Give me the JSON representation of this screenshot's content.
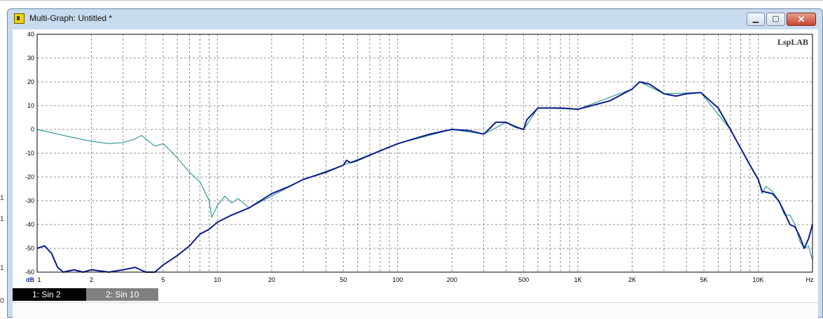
{
  "window": {
    "title": "Multi-Graph: Untitled *",
    "buttons": {
      "minimize": "▁",
      "maximize": "▢",
      "close": "✕"
    }
  },
  "background": {
    "y_ticks": [
      "1",
      "1",
      "1",
      "0"
    ]
  },
  "tabs": [
    {
      "label": "1: Sin 2",
      "active": true
    },
    {
      "label": "2: Sin 10",
      "active": false
    }
  ],
  "chart_data": {
    "type": "line",
    "watermark": "LspLAB",
    "xlabel": "Hz",
    "ylabel": "dB",
    "x_scale": "log",
    "xlim": [
      1,
      20000
    ],
    "ylim": [
      -60,
      40
    ],
    "grid": true,
    "x_ticks": [
      {
        "v": 1,
        "label": "1"
      },
      {
        "v": 2,
        "label": "2"
      },
      {
        "v": 5,
        "label": "5"
      },
      {
        "v": 10,
        "label": "10"
      },
      {
        "v": 20,
        "label": "20"
      },
      {
        "v": 50,
        "label": "50"
      },
      {
        "v": 100,
        "label": "100"
      },
      {
        "v": 200,
        "label": "200"
      },
      {
        "v": 500,
        "label": "500"
      },
      {
        "v": 1000,
        "label": "1K"
      },
      {
        "v": 2000,
        "label": "2K"
      },
      {
        "v": 5000,
        "label": "5K"
      },
      {
        "v": 10000,
        "label": "10K"
      }
    ],
    "y_ticks": [
      40,
      30,
      20,
      10,
      0,
      -10,
      -20,
      -30,
      -40,
      -50,
      -60
    ],
    "colors": {
      "series_1": "#0a1a8c",
      "series_2": "#138a8a",
      "grid": "#909090",
      "frame": "#000000"
    },
    "series": [
      {
        "id": "sin-2",
        "points": [
          [
            1,
            -50
          ],
          [
            1.1,
            -49
          ],
          [
            1.2,
            -52
          ],
          [
            1.3,
            -58
          ],
          [
            1.4,
            -60
          ],
          [
            1.6,
            -59
          ],
          [
            1.8,
            -60
          ],
          [
            2.0,
            -59
          ],
          [
            2.5,
            -60
          ],
          [
            3,
            -59
          ],
          [
            3.5,
            -58
          ],
          [
            4,
            -60
          ],
          [
            4.5,
            -60
          ],
          [
            5,
            -57
          ],
          [
            6,
            -53
          ],
          [
            7,
            -49
          ],
          [
            8,
            -44
          ],
          [
            9,
            -42
          ],
          [
            10,
            -39
          ],
          [
            12,
            -36
          ],
          [
            15,
            -33
          ],
          [
            20,
            -27
          ],
          [
            25,
            -24
          ],
          [
            30,
            -21
          ],
          [
            40,
            -18
          ],
          [
            50,
            -15
          ],
          [
            52,
            -13
          ],
          [
            55,
            -14
          ],
          [
            60,
            -13
          ],
          [
            80,
            -9
          ],
          [
            100,
            -6
          ],
          [
            150,
            -2
          ],
          [
            200,
            0
          ],
          [
            250,
            -0.5
          ],
          [
            300,
            -2
          ],
          [
            320,
            0
          ],
          [
            350,
            3
          ],
          [
            400,
            3
          ],
          [
            450,
            1
          ],
          [
            500,
            0
          ],
          [
            520,
            4
          ],
          [
            600,
            9
          ],
          [
            800,
            9
          ],
          [
            1000,
            8.5
          ],
          [
            1500,
            12
          ],
          [
            2000,
            17
          ],
          [
            2200,
            20
          ],
          [
            2500,
            19
          ],
          [
            3000,
            15
          ],
          [
            3500,
            14
          ],
          [
            4000,
            15
          ],
          [
            4800,
            15.5
          ],
          [
            6000,
            9
          ],
          [
            7000,
            0
          ],
          [
            8000,
            -8
          ],
          [
            9000,
            -15
          ],
          [
            10000,
            -21
          ],
          [
            10500,
            -26
          ],
          [
            12000,
            -27
          ],
          [
            13000,
            -30
          ],
          [
            14000,
            -35
          ],
          [
            15000,
            -40
          ],
          [
            16000,
            -41
          ],
          [
            17000,
            -45
          ],
          [
            18000,
            -50
          ],
          [
            19000,
            -46
          ],
          [
            20000,
            -40
          ]
        ]
      },
      {
        "id": "sin-10",
        "points": [
          [
            1,
            0
          ],
          [
            1.5,
            -3
          ],
          [
            2,
            -5
          ],
          [
            2.5,
            -6
          ],
          [
            3,
            -5.5
          ],
          [
            3.5,
            -4
          ],
          [
            3.8,
            -2.5
          ],
          [
            4,
            -4
          ],
          [
            4.5,
            -7
          ],
          [
            5,
            -6
          ],
          [
            5.5,
            -9
          ],
          [
            6,
            -12
          ],
          [
            7,
            -18
          ],
          [
            8,
            -22
          ],
          [
            9,
            -30
          ],
          [
            9.3,
            -37
          ],
          [
            10,
            -32
          ],
          [
            11,
            -28
          ],
          [
            12,
            -31
          ],
          [
            13,
            -29
          ],
          [
            15,
            -33
          ],
          [
            20,
            -28
          ],
          [
            30,
            -21
          ],
          [
            50,
            -15
          ],
          [
            100,
            -6
          ],
          [
            200,
            0
          ],
          [
            300,
            -2
          ],
          [
            400,
            3
          ],
          [
            500,
            0
          ],
          [
            600,
            9
          ],
          [
            1000,
            8.5
          ],
          [
            2000,
            17
          ],
          [
            2200,
            20
          ],
          [
            3000,
            15
          ],
          [
            4800,
            15.5
          ],
          [
            7000,
            0
          ],
          [
            9000,
            -15
          ],
          [
            10000,
            -21
          ],
          [
            10500,
            -27
          ],
          [
            11000,
            -24
          ],
          [
            12000,
            -26
          ],
          [
            13000,
            -30
          ],
          [
            14000,
            -36
          ],
          [
            15000,
            -36
          ],
          [
            16000,
            -40
          ],
          [
            17000,
            -47
          ],
          [
            18000,
            -50
          ],
          [
            19000,
            -49
          ],
          [
            20000,
            -55
          ]
        ]
      }
    ]
  }
}
